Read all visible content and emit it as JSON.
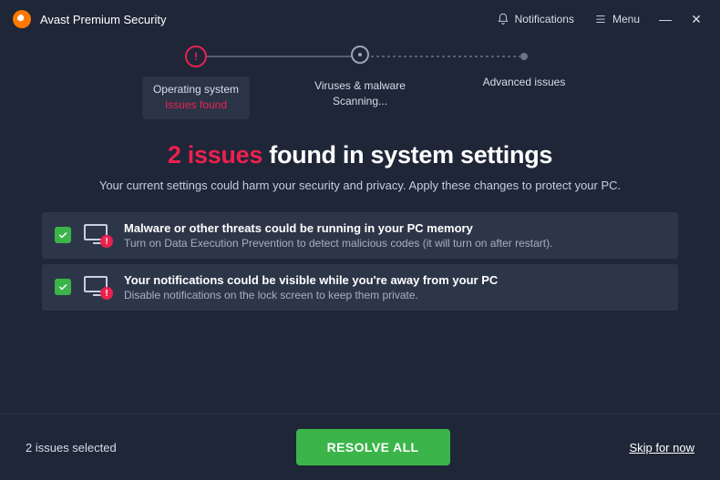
{
  "header": {
    "app_title": "Avast Premium Security",
    "notifications": "Notifications",
    "menu": "Menu"
  },
  "steps": [
    {
      "title": "Operating system",
      "status": "Issues found"
    },
    {
      "title": "Viruses & malware",
      "status": "Scanning..."
    },
    {
      "title": "Advanced issues",
      "status": ""
    }
  ],
  "main": {
    "heading_accent": "2 issues",
    "heading_rest": " found in system settings",
    "subheading": "Your current settings could harm your security and privacy. Apply these changes to protect your PC."
  },
  "issues": [
    {
      "checked": true,
      "title": "Malware or other threats could be running in your PC memory",
      "desc": "Turn on Data Execution Prevention to detect malicious codes (it will turn on after restart)."
    },
    {
      "checked": true,
      "title": "Your notifications could be visible while you're away from your PC",
      "desc": "Disable notifications on the lock screen to keep them private."
    }
  ],
  "footer": {
    "selected_text": "2 issues selected",
    "resolve": "RESOLVE ALL",
    "skip": "Skip for now"
  }
}
